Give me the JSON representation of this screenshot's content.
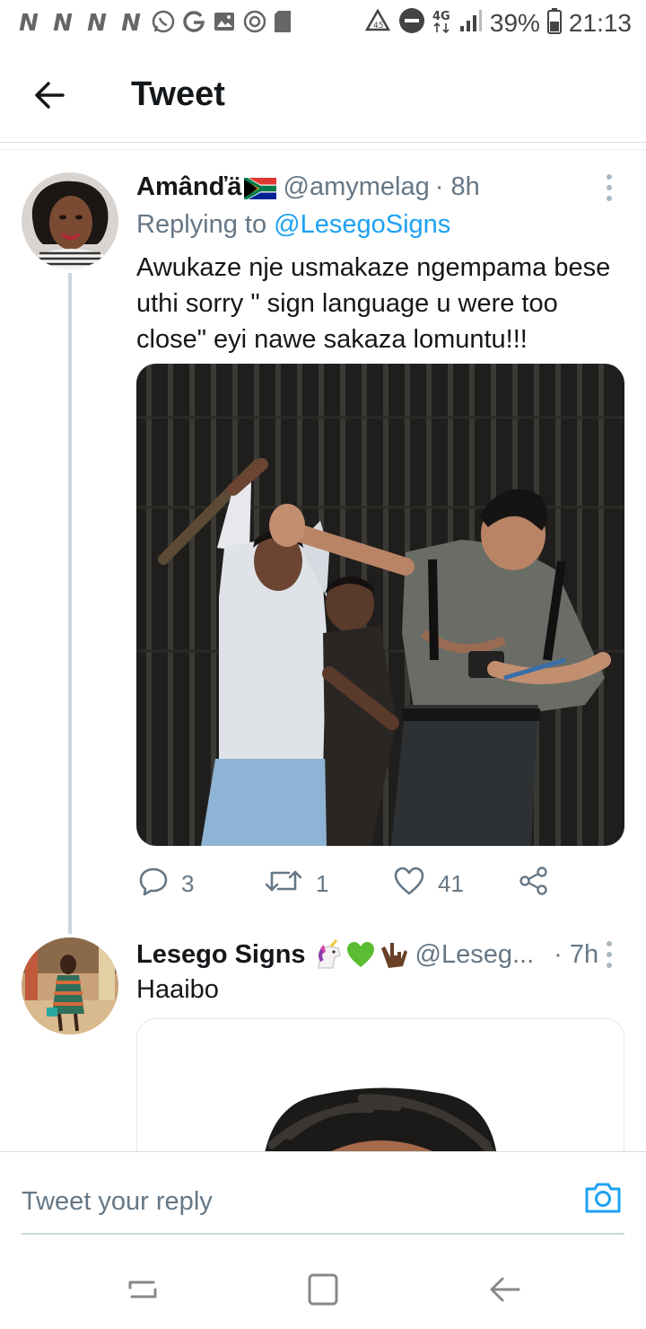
{
  "status_bar": {
    "left_letters": [
      "N",
      "N",
      "N",
      "N"
    ],
    "left_icons": [
      "whatsapp-icon",
      "google-icon",
      "gallery-icon",
      "sync-icon",
      "sd-card-icon"
    ],
    "right_icons": [
      "recycle-icon",
      "do-not-disturb-icon",
      "4g-icon",
      "signal-icon",
      "battery-icon"
    ],
    "network": "4G",
    "battery": "39%",
    "time": "21:13"
  },
  "header": {
    "title": "Tweet",
    "back_icon": "back-arrow-icon"
  },
  "tweet1": {
    "name": "Amânďä",
    "flag_icon": "south-africa-flag-icon",
    "handle": "@amymelag",
    "time": "· 8h",
    "replying_prefix": "Replying to",
    "replying_to": "@LesegoSigns",
    "text": "Awukaze nje usmakaze ngempama bese uthi sorry \" sign language u were too close\" eyi nawe sakaza lomuntu!!!",
    "actions": {
      "replies": "3",
      "retweets": "1",
      "likes": "41"
    }
  },
  "tweet2": {
    "name": "Lesego Signs",
    "name_emojis": [
      "unicorn-emoji",
      "green-heart-emoji",
      "i-love-you-hand-emoji"
    ],
    "handle": "@Leseg...",
    "time": "· 7h",
    "text": "Haaibo"
  },
  "reply_bar": {
    "placeholder": "Tweet your reply",
    "camera_icon": "camera-icon"
  },
  "nav_bar": {
    "icons": [
      "recent-apps-icon",
      "home-icon",
      "back-icon"
    ]
  },
  "colors": {
    "accent": "#1da1f2",
    "secondary_text": "#657786",
    "primary_text": "#14171a",
    "divider": "#e6ecf0"
  }
}
